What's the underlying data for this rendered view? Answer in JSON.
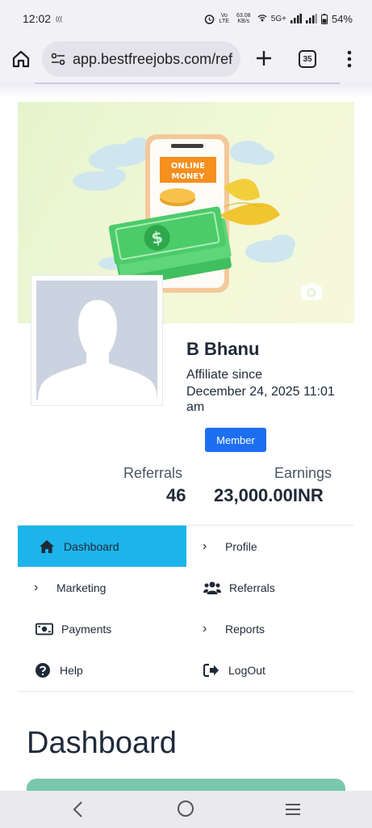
{
  "status_bar": {
    "time": "12:02",
    "wifi_calling": "(((",
    "volte": "Vo LTE",
    "network_speed": "63.08 KB/s",
    "network_type": "5G+",
    "battery": "54%"
  },
  "browser": {
    "url": "app.bestfreejobs.com/ref",
    "tab_count": "35",
    "icons": [
      "home-icon",
      "site-settings-icon",
      "plus-icon",
      "tabs-icon",
      "more-vert-icon"
    ]
  },
  "cover": {
    "sign_text_1": "ONLINE",
    "sign_text_2": "MONEY",
    "currency_symbol": "$"
  },
  "profile": {
    "name": "B Bhanu",
    "affiliate_since_label": "Affiliate since",
    "affiliate_date": "December 24, 2025 11:01 am",
    "badge": "Member",
    "referrals_label": "Referrals",
    "referrals_value": "46",
    "earnings_label": "Earnings",
    "earnings_value": "23,000.00INR"
  },
  "menu": {
    "dashboard": "Dashboard",
    "profile": "Profile",
    "marketing": "Marketing",
    "referrals": "Referrals",
    "payments": "Payments",
    "reports": "Reports",
    "help": "Help",
    "logout": "LogOut"
  },
  "main": {
    "title": "Dashboard"
  },
  "colors": {
    "accent_blue": "#1d6ff2",
    "active_menu": "#1cb4ea",
    "card_green": "#79c8ac"
  }
}
